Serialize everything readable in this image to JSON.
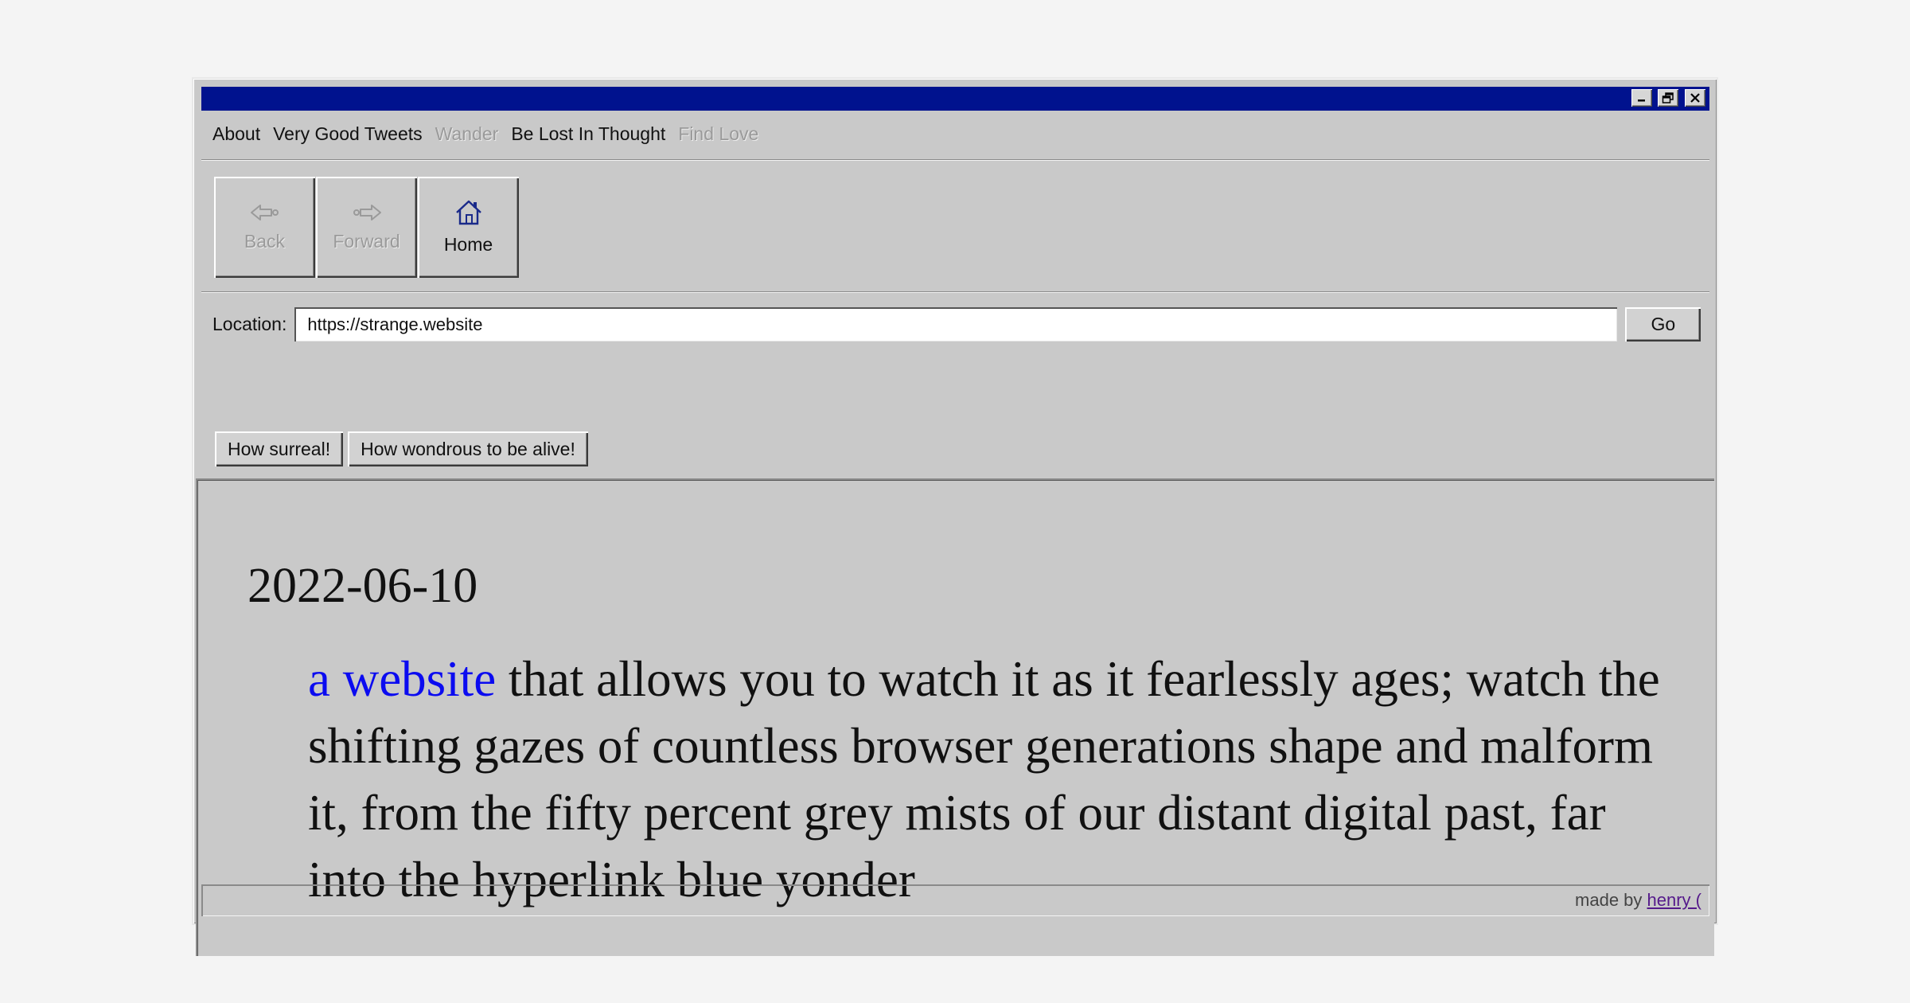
{
  "window": {
    "controls": [
      {
        "name": "minimize",
        "icon": "minimize-icon"
      },
      {
        "name": "restore",
        "icon": "restore-icon"
      },
      {
        "name": "close",
        "icon": "close-icon"
      }
    ]
  },
  "menu": {
    "items": [
      {
        "label": "About",
        "enabled": true
      },
      {
        "label": "Very Good Tweets",
        "enabled": true
      },
      {
        "label": "Wander",
        "enabled": false
      },
      {
        "label": "Be Lost In Thought",
        "enabled": true
      },
      {
        "label": "Find Love",
        "enabled": false
      }
    ]
  },
  "toolbar": {
    "back": {
      "label": "Back",
      "icon": "back-arrow-icon",
      "enabled": false
    },
    "forward": {
      "label": "Forward",
      "icon": "forward-arrow-icon",
      "enabled": false
    },
    "home": {
      "label": "Home",
      "icon": "home-icon",
      "enabled": true
    }
  },
  "location": {
    "label": "Location:",
    "value": "https://strange.website",
    "go_label": "Go"
  },
  "bookmarks": [
    {
      "label": "How surreal!"
    },
    {
      "label": "How wondrous to be alive!"
    }
  ],
  "post": {
    "date": "2022-06-10",
    "link_text": "a website",
    "body_text": " that allows you to watch it as it fearlessly ages; watch the shifting gazes of countless browser generations shape and malform it, from the fifty percent grey mists of our distant digital past, far into the hyperlink blue yonder"
  },
  "status": {
    "credit_prefix": "made by ",
    "credit_link": "henry ("
  },
  "colors": {
    "titlebar": "#00128e",
    "link": "#0b0bf0",
    "visited_link": "#551a8b",
    "chrome": "#c9c9c9",
    "page_background": "#f4f4f4"
  }
}
